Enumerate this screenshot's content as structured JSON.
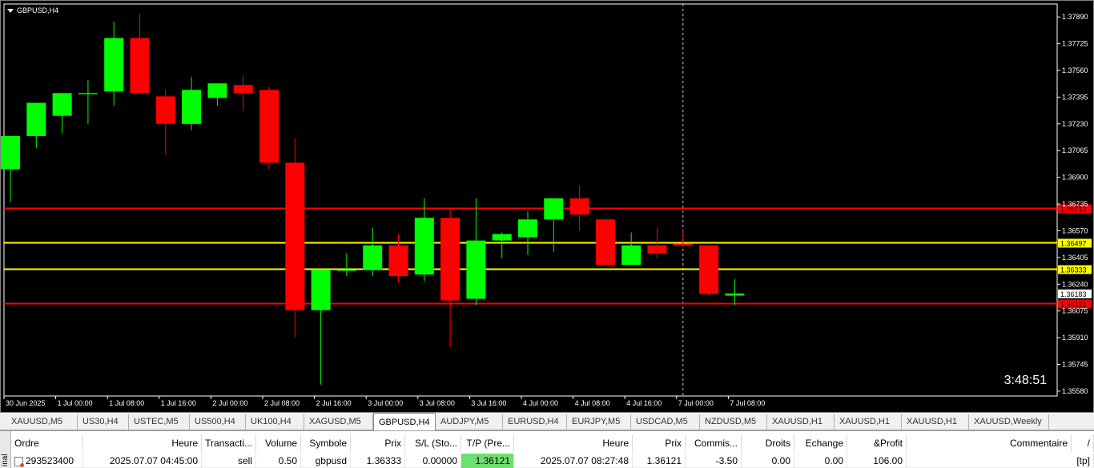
{
  "chart": {
    "title": "GBPUSD,H4",
    "countdown": "3:48:51",
    "price_axis": [
      "1.37890",
      "1.37725",
      "1.37560",
      "1.37395",
      "1.37230",
      "1.37065",
      "1.36900",
      "1.36735",
      "1.36570",
      "1.36405",
      "1.36240",
      "1.36075",
      "1.35910",
      "1.35745",
      "1.35580"
    ],
    "time_axis": [
      "30 Jun 2025",
      "1 Jul 00:00",
      "1 Jul 08:00",
      "1 Jul 16:00",
      "2 Jul 00:00",
      "2 Jul 08:00",
      "2 Jul 16:00",
      "3 Jul 00:00",
      "3 Jul 08:00",
      "3 Jul 16:00",
      "4 Jul 00:00",
      "4 Jul 08:00",
      "4 Jul 16:00",
      "7 Jul 00:00",
      "7 Jul 08:00"
    ],
    "hlines": [
      {
        "price": 1.36712,
        "label": "1.36712",
        "color": "#ff0000"
      },
      {
        "price": 1.36497,
        "label": "1.36497",
        "color": "#ffff00"
      },
      {
        "price": 1.36333,
        "label": "1.36333",
        "color": "#ffff00"
      },
      {
        "price": 1.36121,
        "label": "1.36121",
        "color": "#ff0000"
      }
    ],
    "current_price": "1.36183",
    "bull_color": "#00ff00",
    "bear_color": "#ff0000"
  },
  "chart_data": {
    "type": "candlestick",
    "symbol": "GBPUSD",
    "timeframe": "H4",
    "ylim": [
      1.3555,
      1.3797
    ],
    "candles": [
      {
        "o": 1.3695,
        "h": 1.3715,
        "l": 1.3675,
        "c": 1.37155
      },
      {
        "o": 1.37155,
        "h": 1.3735,
        "l": 1.3708,
        "c": 1.3736
      },
      {
        "o": 1.3728,
        "h": 1.3742,
        "l": 1.3717,
        "c": 1.3742
      },
      {
        "o": 1.3742,
        "h": 1.375,
        "l": 1.3723,
        "c": 1.3742
      },
      {
        "o": 1.3743,
        "h": 1.3786,
        "l": 1.3734,
        "c": 1.3776
      },
      {
        "o": 1.3776,
        "h": 1.3791,
        "l": 1.3743,
        "c": 1.3742
      },
      {
        "o": 1.374,
        "h": 1.3744,
        "l": 1.3704,
        "c": 1.3723
      },
      {
        "o": 1.3723,
        "h": 1.3752,
        "l": 1.3719,
        "c": 1.3744
      },
      {
        "o": 1.3739,
        "h": 1.3748,
        "l": 1.3734,
        "c": 1.3748
      },
      {
        "o": 1.3747,
        "h": 1.3753,
        "l": 1.3731,
        "c": 1.3742
      },
      {
        "o": 1.3744,
        "h": 1.3746,
        "l": 1.3695,
        "c": 1.3699
      },
      {
        "o": 1.3699,
        "h": 1.3714,
        "l": 1.3591,
        "c": 1.3608
      },
      {
        "o": 1.3608,
        "h": 1.3633,
        "l": 1.3562,
        "c": 1.3633
      },
      {
        "o": 1.3633,
        "h": 1.3643,
        "l": 1.3629,
        "c": 1.3633
      },
      {
        "o": 1.3633,
        "h": 1.3659,
        "l": 1.3629,
        "c": 1.3648
      },
      {
        "o": 1.3648,
        "h": 1.3655,
        "l": 1.3625,
        "c": 1.3629
      },
      {
        "o": 1.363,
        "h": 1.3677,
        "l": 1.3626,
        "c": 1.3665
      },
      {
        "o": 1.3665,
        "h": 1.367,
        "l": 1.3585,
        "c": 1.3614
      },
      {
        "o": 1.3615,
        "h": 1.3677,
        "l": 1.3611,
        "c": 1.3651
      },
      {
        "o": 1.3651,
        "h": 1.3656,
        "l": 1.364,
        "c": 1.3655
      },
      {
        "o": 1.3653,
        "h": 1.3669,
        "l": 1.3642,
        "c": 1.3664
      },
      {
        "o": 1.3664,
        "h": 1.3677,
        "l": 1.3644,
        "c": 1.3677
      },
      {
        "o": 1.3677,
        "h": 1.3685,
        "l": 1.3657,
        "c": 1.3667
      },
      {
        "o": 1.3664,
        "h": 1.3664,
        "l": 1.3636,
        "c": 1.3636
      },
      {
        "o": 1.3636,
        "h": 1.3656,
        "l": 1.3636,
        "c": 1.3648
      },
      {
        "o": 1.3648,
        "h": 1.3659,
        "l": 1.364,
        "c": 1.3643
      },
      {
        "o": 1.3649,
        "h": 1.3658,
        "l": 1.3647,
        "c": 1.3648
      },
      {
        "o": 1.3648,
        "h": 1.3648,
        "l": 1.3617,
        "c": 1.3618
      },
      {
        "o": 1.3617,
        "h": 1.3627,
        "l": 1.3611,
        "c": 1.36183
      }
    ]
  },
  "tabs": [
    "XAUUSD,M5",
    "US30,H4",
    "USTEC,M5",
    "US500,H4",
    "UK100,H4",
    "XAGUSD,M5",
    "GBPUSD,H4",
    "AUDJPY,M5",
    "EURUSD,H4",
    "EURJPY,M5",
    "USDCAD,M5",
    "NZDUSD,M5",
    "XAUUSD,H1",
    "XAUUSD,H1",
    "XAUUSD,H1",
    "XAUUSD,Weekly"
  ],
  "active_tab": "GBPUSD,H4",
  "terminal": {
    "side_label": "inal",
    "columns": [
      "Ordre",
      "Heure",
      "Transacti...",
      "Volume",
      "Symbole",
      "Prix",
      "S/L (Sto...",
      "T/P (Pre...",
      "Heure",
      "Prix",
      "Commis...",
      "Droits",
      "Echange",
      "&Profit",
      "Commentaire",
      "/"
    ],
    "row": [
      "293523400",
      "2025.07.07 04:45:00",
      "sell",
      "0.50",
      "gbpusd",
      "1.36333",
      "0.00000",
      "1.36121",
      "2025.07.07 08:27:48",
      "1.36121",
      "-3.50",
      "0.00",
      "0.00",
      "106.00",
      "[tp]"
    ]
  }
}
